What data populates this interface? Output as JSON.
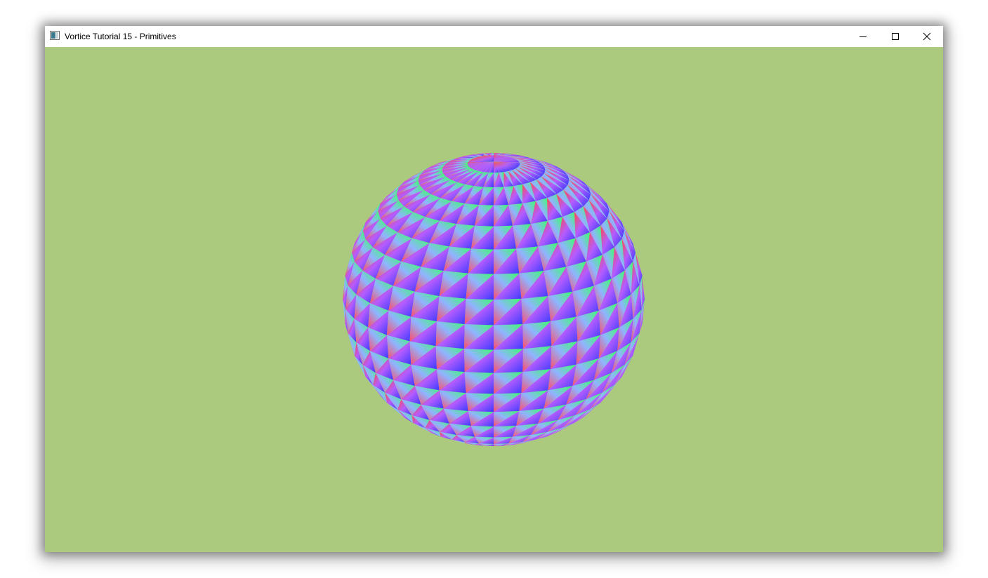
{
  "window": {
    "title": "Vortice Tutorial 15 - Primitives",
    "app_icon": "window-app-icon",
    "controls": {
      "minimize_icon": "minimize-icon",
      "maximize_icon": "maximize-icon",
      "close_icon": "close-icon"
    }
  },
  "scene": {
    "background_color": "#abca7d",
    "primitive": "sphere",
    "shading": "vertex-color rainbow gradient per triangle",
    "vertex_colors": [
      "#ff3b3b",
      "#3bff5a",
      "#3b3bff"
    ]
  }
}
